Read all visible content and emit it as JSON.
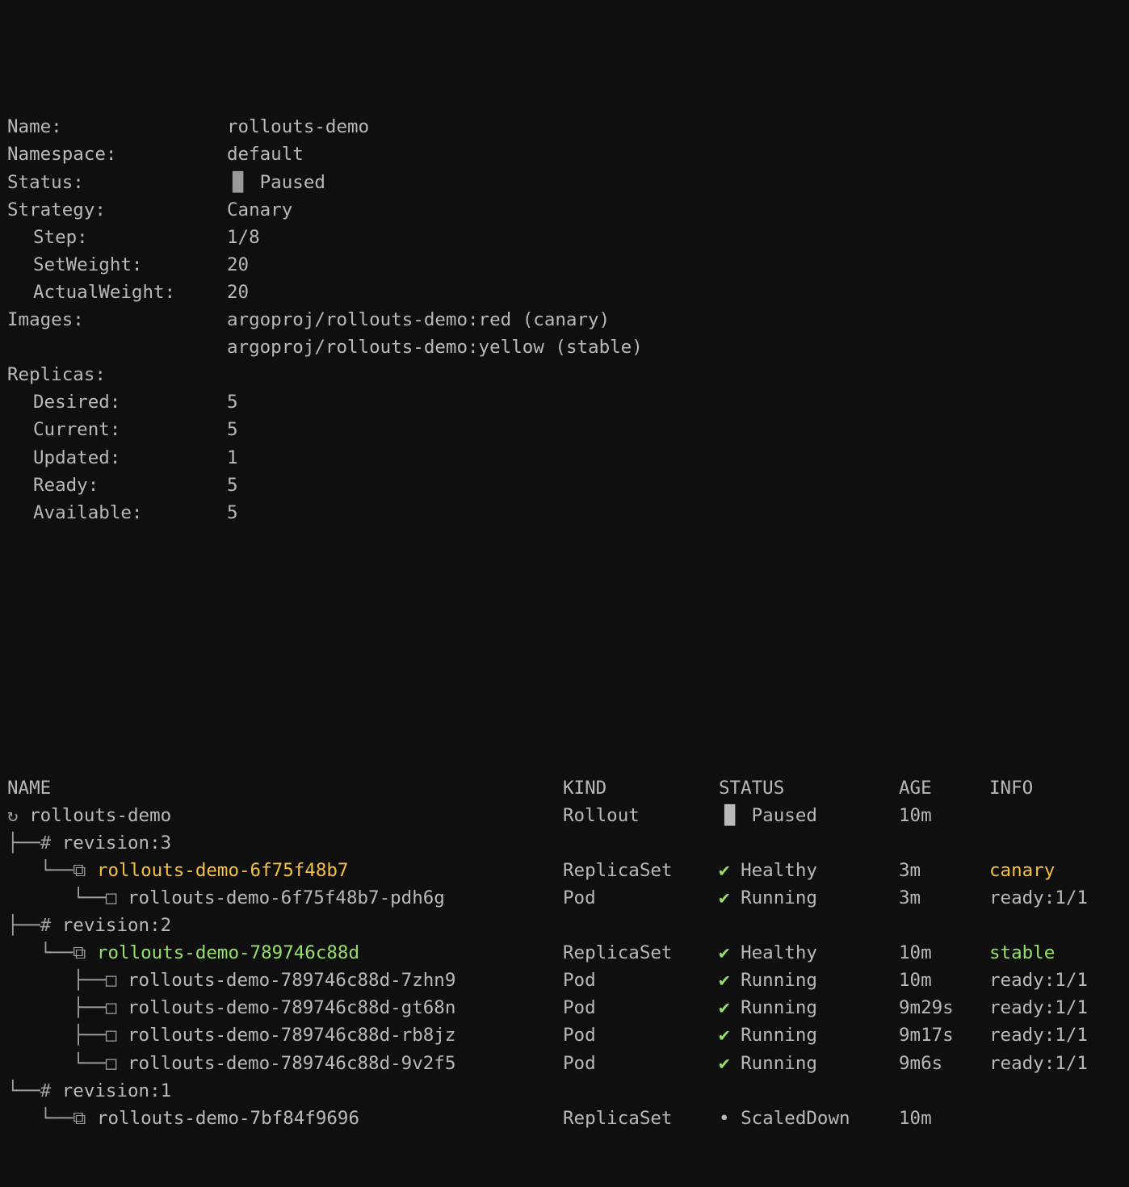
{
  "terminal": {
    "background": "#0f0f0f",
    "foreground": "#b9b9b9",
    "accent_canary": "#f2c140",
    "accent_stable": "#96e06a"
  },
  "summary": {
    "rows": [
      {
        "key": "Name:",
        "value": "rollouts-demo",
        "indent": false
      },
      {
        "key": "Namespace:",
        "value": "default",
        "indent": false
      },
      {
        "key": "Status:",
        "value": "Paused",
        "icon": "pause-icon",
        "icon_glyph": "▐▌",
        "indent": false
      },
      {
        "key": "Strategy:",
        "value": "Canary",
        "indent": false
      },
      {
        "key": "Step:",
        "value": "1/8",
        "indent": true
      },
      {
        "key": "SetWeight:",
        "value": "20",
        "indent": true
      },
      {
        "key": "ActualWeight:",
        "value": "20",
        "indent": true
      }
    ],
    "images_label": "Images:",
    "images": [
      {
        "image": "argoproj/rollouts-demo:red",
        "tag": "canary",
        "tag_color": "canary"
      },
      {
        "image": "argoproj/rollouts-demo:yellow",
        "tag": "stable",
        "tag_color": "stable"
      }
    ],
    "replicas_label": "Replicas:",
    "replicas": [
      {
        "key": "Desired:",
        "value": "5"
      },
      {
        "key": "Current:",
        "value": "5"
      },
      {
        "key": "Updated:",
        "value": "1"
      },
      {
        "key": "Ready:",
        "value": "5"
      },
      {
        "key": "Available:",
        "value": "5"
      }
    ]
  },
  "table": {
    "headers": {
      "name": "NAME",
      "kind": "KIND",
      "status": "STATUS",
      "age": "AGE",
      "info": "INFO"
    },
    "rows": [
      {
        "type": "rollout",
        "tree": "",
        "icon": "rotate-icon",
        "icon_glyph": "↻",
        "name": "rollouts-demo",
        "name_color": "gray",
        "kind": "Rollout",
        "status": "Paused",
        "status_icon": "pause-icon",
        "status_icon_glyph": "▐▌",
        "status_icon_color": "gray",
        "age": "10m",
        "info": "",
        "info_color": "gray"
      },
      {
        "type": "revision",
        "tree": "├──",
        "icon": "hash-icon",
        "icon_glyph": "#",
        "name": "revision:3",
        "name_color": "gray",
        "kind": "",
        "status": "",
        "age": "",
        "info": ""
      },
      {
        "type": "replicaset",
        "tree": "   └──",
        "icon": "replicaset-icon",
        "icon_glyph": "⧉",
        "name": "rollouts-demo-6f75f48b7",
        "name_color": "orange",
        "kind": "ReplicaSet",
        "status": "Healthy",
        "status_icon": "check-icon",
        "status_icon_glyph": "✔",
        "status_icon_color": "green",
        "age": "3m",
        "info": "canary",
        "info_color": "orange"
      },
      {
        "type": "pod",
        "tree": "      └──",
        "icon": "pod-icon",
        "icon_glyph": "□",
        "name": "rollouts-demo-6f75f48b7-pdh6g",
        "name_color": "gray",
        "kind": "Pod",
        "status": "Running",
        "status_icon": "check-icon",
        "status_icon_glyph": "✔",
        "status_icon_color": "green",
        "age": "3m",
        "info": "ready:1/1",
        "info_color": "gray"
      },
      {
        "type": "revision",
        "tree": "├──",
        "icon": "hash-icon",
        "icon_glyph": "#",
        "name": "revision:2",
        "name_color": "gray",
        "kind": "",
        "status": "",
        "age": "",
        "info": ""
      },
      {
        "type": "replicaset",
        "tree": "   └──",
        "icon": "replicaset-icon",
        "icon_glyph": "⧉",
        "name": "rollouts-demo-789746c88d",
        "name_color": "green",
        "kind": "ReplicaSet",
        "status": "Healthy",
        "status_icon": "check-icon",
        "status_icon_glyph": "✔",
        "status_icon_color": "green",
        "age": "10m",
        "info": "stable",
        "info_color": "green"
      },
      {
        "type": "pod",
        "tree": "      ├──",
        "icon": "pod-icon",
        "icon_glyph": "□",
        "name": "rollouts-demo-789746c88d-7zhn9",
        "name_color": "gray",
        "kind": "Pod",
        "status": "Running",
        "status_icon": "check-icon",
        "status_icon_glyph": "✔",
        "status_icon_color": "green",
        "age": "10m",
        "info": "ready:1/1",
        "info_color": "gray"
      },
      {
        "type": "pod",
        "tree": "      ├──",
        "icon": "pod-icon",
        "icon_glyph": "□",
        "name": "rollouts-demo-789746c88d-gt68n",
        "name_color": "gray",
        "kind": "Pod",
        "status": "Running",
        "status_icon": "check-icon",
        "status_icon_glyph": "✔",
        "status_icon_color": "green",
        "age": "9m29s",
        "info": "ready:1/1",
        "info_color": "gray"
      },
      {
        "type": "pod",
        "tree": "      ├──",
        "icon": "pod-icon",
        "icon_glyph": "□",
        "name": "rollouts-demo-789746c88d-rb8jz",
        "name_color": "gray",
        "kind": "Pod",
        "status": "Running",
        "status_icon": "check-icon",
        "status_icon_glyph": "✔",
        "status_icon_color": "green",
        "age": "9m17s",
        "info": "ready:1/1",
        "info_color": "gray"
      },
      {
        "type": "pod",
        "tree": "      └──",
        "icon": "pod-icon",
        "icon_glyph": "□",
        "name": "rollouts-demo-789746c88d-9v2f5",
        "name_color": "gray",
        "kind": "Pod",
        "status": "Running",
        "status_icon": "check-icon",
        "status_icon_glyph": "✔",
        "status_icon_color": "green",
        "age": "9m6s",
        "info": "ready:1/1",
        "info_color": "gray"
      },
      {
        "type": "revision",
        "tree": "└──",
        "icon": "hash-icon",
        "icon_glyph": "#",
        "name": "revision:1",
        "name_color": "gray",
        "kind": "",
        "status": "",
        "age": "",
        "info": ""
      },
      {
        "type": "replicaset",
        "tree": "   └──",
        "icon": "replicaset-icon",
        "icon_glyph": "⧉",
        "name": "rollouts-demo-7bf84f9696",
        "name_color": "gray",
        "kind": "ReplicaSet",
        "status": "ScaledDown",
        "status_icon": "dot-icon",
        "status_icon_glyph": "•",
        "status_icon_color": "gray",
        "age": "10m",
        "info": "",
        "info_color": "gray"
      }
    ]
  }
}
